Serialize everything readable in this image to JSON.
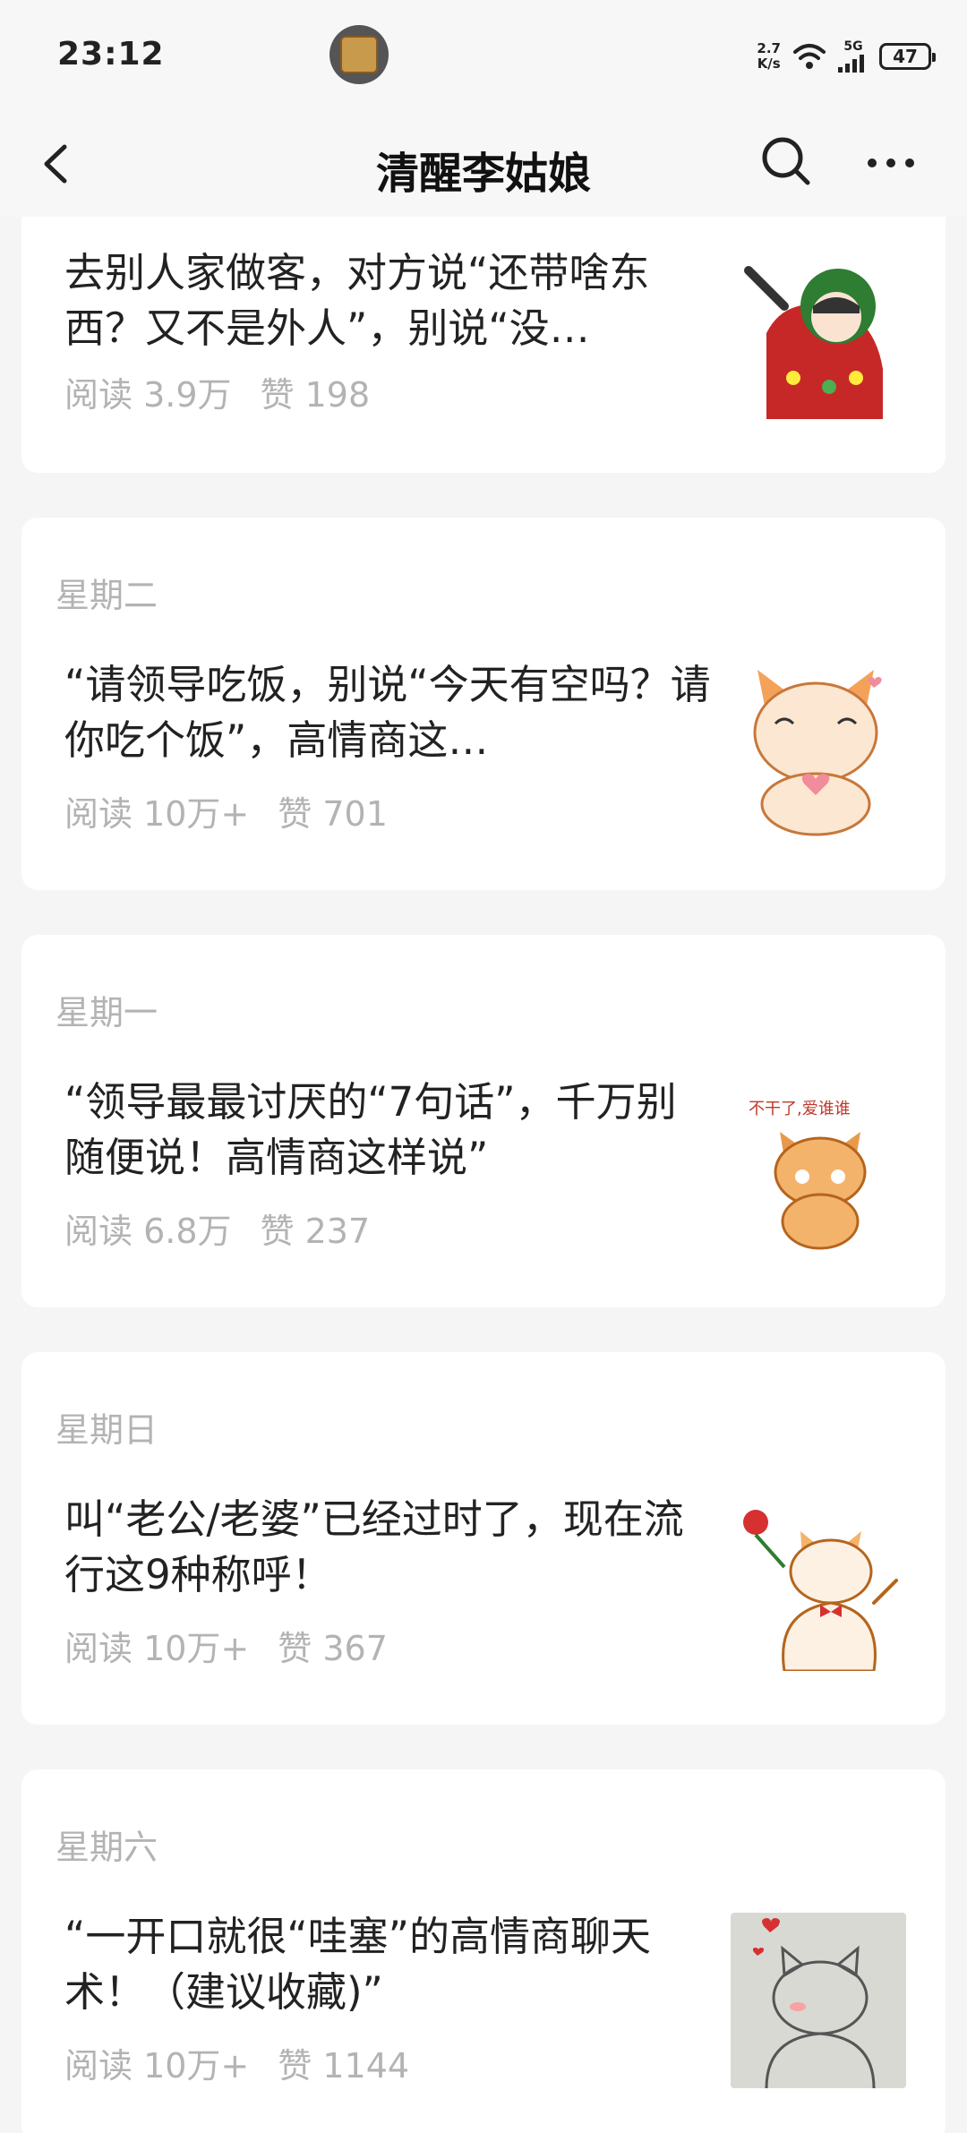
{
  "status_bar": {
    "time": "23:12",
    "net_speed_value": "2.7",
    "net_speed_unit": "K/s",
    "signal": "5G",
    "battery": "47"
  },
  "nav": {
    "title": "清醒李姑娘"
  },
  "articles": [
    {
      "day": "",
      "title": "去别人家做客，对方说“还带啥东西？又不是外人”，别说“没…",
      "reads": "阅读 3.9万",
      "likes": "赞 198",
      "thumb_icon": "girl-sticker-icon"
    },
    {
      "day": "星期二",
      "title": "“请领导吃饭，别说“今天有空吗？请你吃个饭”，高情商这…",
      "reads": "阅读 10万+",
      "likes": "赞 701",
      "thumb_icon": "cat-heart-sticker-icon"
    },
    {
      "day": "星期一",
      "title": "“领导最最讨厌的“7句话”，千万别随便说！高情商这样说”",
      "reads": "阅读 6.8万",
      "likes": "赞 237",
      "thumb_icon": "cat-shy-sticker-icon",
      "thumb_caption": "不干了,爱谁谁"
    },
    {
      "day": "星期日",
      "title": "叫“老公/老婆”已经过时了，现在流行这9种称呼！",
      "reads": "阅读 10万+",
      "likes": "赞 367",
      "thumb_icon": "cat-rose-sticker-icon"
    },
    {
      "day": "星期六",
      "title": "“一开口就很“哇塞”的高情商聊天术！（建议收藏)”",
      "reads": "阅读 10万+",
      "likes": "赞 1144",
      "thumb_icon": "cat-sketch-sticker-icon"
    }
  ]
}
